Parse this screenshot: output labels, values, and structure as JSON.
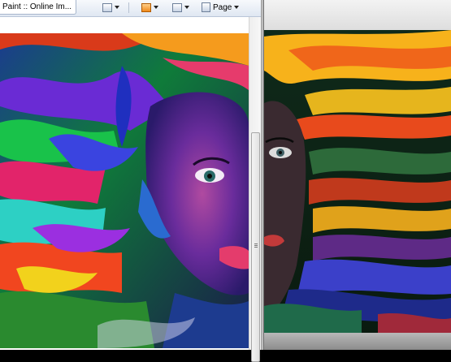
{
  "browser": {
    "tab_title": "Paint :: Online Im...",
    "toolbar": {
      "page_label": "Page"
    }
  },
  "colors": {
    "hair_warm": "#f7a21b",
    "hair_cool": "#3b35d6",
    "background_green": "#1a9b3c",
    "face_purple": "#5b2a86"
  }
}
